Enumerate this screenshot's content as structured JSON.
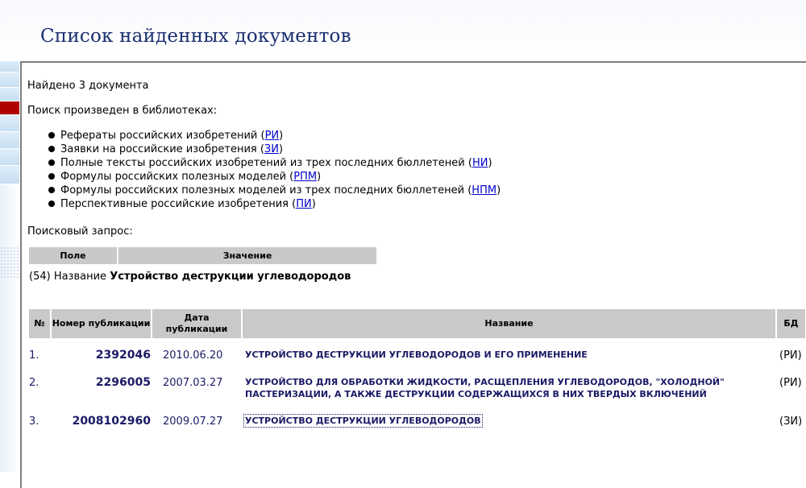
{
  "page": {
    "title": "Список найденных документов"
  },
  "summary": {
    "found": "Найдено 3 документа",
    "libraries_intro": "Поиск произведен в библиотеках:",
    "libraries": [
      {
        "label": "Рефераты российских изобретений (",
        "code": "РИ",
        "suffix": ")"
      },
      {
        "label": "Заявки на российские изобретения (",
        "code": "ЗИ",
        "suffix": ")"
      },
      {
        "label": "Полные тексты российских изобретений из трех последних бюллетеней (",
        "code": "НИ",
        "suffix": ")"
      },
      {
        "label": "Формулы российских полезных моделей (",
        "code": "РПМ",
        "suffix": ")"
      },
      {
        "label": "Формулы российских полезных моделей из трех последних бюллетеней (",
        "code": "НПМ",
        "suffix": ")"
      },
      {
        "label": "Перспективные российские изобретения (",
        "code": "ПИ",
        "suffix": ")"
      }
    ]
  },
  "query": {
    "label": "Поисковый запрос:",
    "headers": {
      "field": "Поле",
      "value": "Значение"
    },
    "row": {
      "field": "(54) Название",
      "value": "Устройство деструкции углеводородов"
    }
  },
  "results": {
    "headers": {
      "no": "№",
      "number": "Номер публикации",
      "date": "Дата публикации",
      "name": "Название",
      "db": "БД"
    },
    "rows": [
      {
        "index": "1.",
        "number": "2392046",
        "date": "2010.06.20",
        "title": "УСТРОЙСТВО ДЕСТРУКЦИИ УГЛЕВОДОРОДОВ И ЕГО ПРИМЕНЕНИЕ",
        "db": "(РИ)"
      },
      {
        "index": "2.",
        "number": "2296005",
        "date": "2007.03.27",
        "title": "УСТРОЙСТВО ДЛЯ ОБРАБОТКИ ЖИДКОСТИ, РАСЩЕПЛЕНИЯ УГЛЕВОДОРОДОВ, \"ХОЛОДНОЙ\" ПАСТЕРИЗАЦИИ, А ТАКЖЕ ДЕСТРУКЦИИ СОДЕРЖАЩИХСЯ В НИХ ТВЕРДЫХ ВКЛЮЧЕНИЙ",
        "db": "(РИ)"
      },
      {
        "index": "3.",
        "number": "2008102960",
        "date": "2009.07.27",
        "title": "УСТРОЙСТВО ДЕСТРУКЦИИ УГЛЕВОДОРОДОВ",
        "db": "(ЗИ)"
      }
    ]
  }
}
